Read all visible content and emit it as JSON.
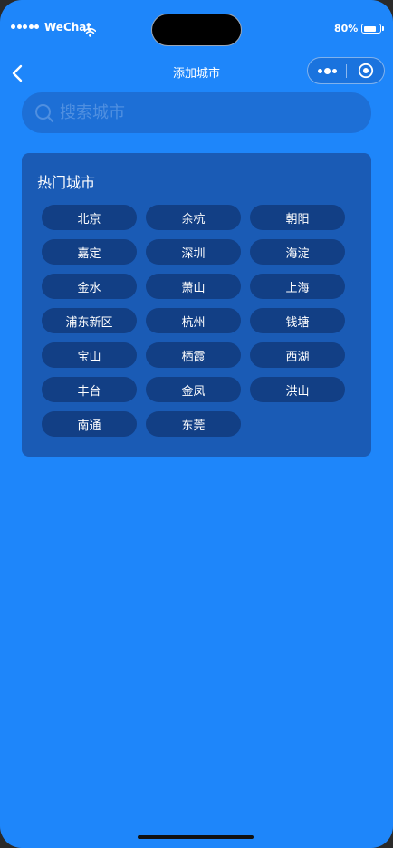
{
  "status_bar": {
    "carrier": "WeChat",
    "battery": "80%",
    "battery_level": 0.8
  },
  "nav": {
    "title": "添加城市"
  },
  "search": {
    "placeholder": "搜索城市",
    "value": ""
  },
  "hot_cities": {
    "title": "热门城市",
    "cities": [
      "北京",
      "余杭",
      "朝阳",
      "嘉定",
      "深圳",
      "海淀",
      "金水",
      "萧山",
      "上海",
      "浦东新区",
      "杭州",
      "钱塘",
      "宝山",
      "栖霞",
      "西湖",
      "丰台",
      "金凤",
      "洪山",
      "南通",
      "东莞"
    ]
  },
  "colors": {
    "background": "#1e86fa",
    "card": "#1a5bb5",
    "chip": "#123f85",
    "search": "#1d6fd6"
  }
}
